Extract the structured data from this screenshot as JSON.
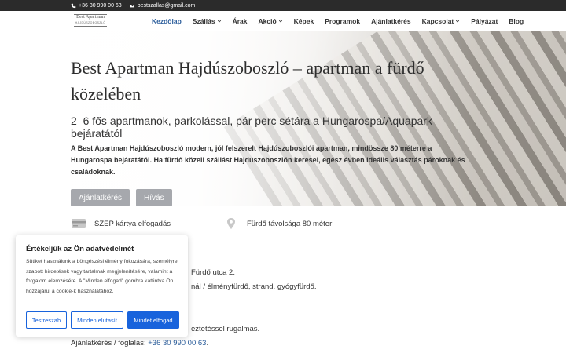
{
  "topbar": {
    "phone": "+36 30 990 00 63",
    "email": "bestszallas@gmail.com"
  },
  "logo": {
    "line1": "Best Apartman",
    "line2": "HAJDÚSZOBOSZLÓ"
  },
  "nav": [
    {
      "label": "Kezdőlap",
      "active": true,
      "dropdown": false
    },
    {
      "label": "Szállás",
      "active": false,
      "dropdown": true
    },
    {
      "label": "Árak",
      "active": false,
      "dropdown": false
    },
    {
      "label": "Akció",
      "active": false,
      "dropdown": true
    },
    {
      "label": "Képek",
      "active": false,
      "dropdown": false
    },
    {
      "label": "Programok",
      "active": false,
      "dropdown": false
    },
    {
      "label": "Ajánlatkérés",
      "active": false,
      "dropdown": false
    },
    {
      "label": "Kapcsolat",
      "active": false,
      "dropdown": true
    },
    {
      "label": "Pályázat",
      "active": false,
      "dropdown": false
    },
    {
      "label": "Blog",
      "active": false,
      "dropdown": false
    }
  ],
  "hero": {
    "title": "Best Apartman Hajdúszoboszló – apartman a fürdő közelében",
    "subtitle": "2–6 fős apartmanok, parkolással, pár perc sétára a Hungarospa/Aquapark bejáratától",
    "description": "A Best Apartman Hajdúszoboszló modern, jól felszerelt Hajdúszoboszlói apartman, mindössze 80 méterre a Hungarospa bejáratától. Ha fürdő közeli szállást Hajdúszoboszlón keresel, egész évben ideális választás pároknak és családoknak.",
    "buttons": [
      "Ajánlatkérés",
      "Hívás"
    ]
  },
  "features": [
    {
      "icon": "credit-card-icon",
      "label": "SZÉP kártya elfogadás"
    },
    {
      "icon": "location-pin-icon",
      "label": "Fürdő távolsága 80 méter"
    }
  ],
  "body": {
    "line1": "Fürdő utca 2.",
    "line2": "nál / élményfürdő, strand, gyógyfürdő.",
    "line3": "eztetéssel rugalmas.",
    "line4_prefix": "Ajánlatkérés / foglalás: ",
    "line4_link": "+36 30 990 00 63",
    "line4_suffix": "."
  },
  "cookie": {
    "title": "Értékeljük az Ön adatvédelmét",
    "text": "Sütiket használunk a böngészési élmény fokozására, személyre szabott hirdetések vagy tartalmak megjelenítésére, valamint a forgalom elemzésére. A \"Minden elfogad\" gombra kattintva Ön hozzájárul a cookie-k használatához.",
    "buttons": {
      "customize": "Testreszab",
      "reject": "Minden elutasít",
      "accept": "Mindet elfogad"
    }
  },
  "colors": {
    "accent": "#2b5d9b",
    "cookie_primary": "#1863dc",
    "hero_button": "#a6a8ad",
    "topbar": "#2b2b2b"
  }
}
